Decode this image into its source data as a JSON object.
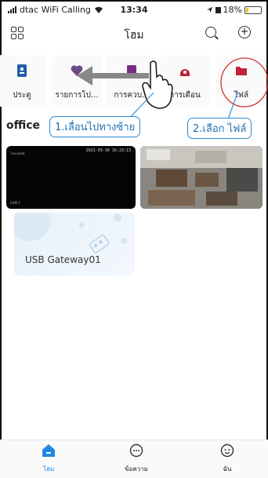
{
  "status_bar": {
    "carrier": "dtac WiFi Calling",
    "time": "13:34",
    "battery_percent": "18%",
    "battery_level": 0.18
  },
  "header": {
    "title": "โฮม"
  },
  "toolbar": {
    "items": [
      {
        "label": "ประตู",
        "icon": "door-lock-icon",
        "color": "#1f5ea8"
      },
      {
        "label": "รายการโป...",
        "icon": "heart-icon",
        "color": "#6b4a8c"
      },
      {
        "label": "การควบ...",
        "icon": "control-icon",
        "color": "#7a2d86"
      },
      {
        "label": "การเตือน",
        "icon": "alert-icon",
        "color": "#c0233a"
      },
      {
        "label": "ไฟล์",
        "icon": "folder-icon",
        "color": "#c0233a"
      }
    ]
  },
  "section": {
    "title": "office"
  },
  "annotations": {
    "step1": "1.เลื่อนไปทางซ้าย",
    "step2": "2.เลือก ไฟล์"
  },
  "cameras": [
    {
      "timestamp": "2021-03-30 16:23:13",
      "label": "โรงแรมร์ท",
      "name": "CAM 1"
    },
    {
      "timestamp": "",
      "label": "",
      "name": ""
    }
  ],
  "gateway": {
    "name": "USB Gateway01"
  },
  "tabbar": {
    "items": [
      {
        "label": "โฮม",
        "icon": "home-icon",
        "active": true
      },
      {
        "label": "ข้อความ",
        "icon": "message-icon",
        "active": false
      },
      {
        "label": "ฉัน",
        "icon": "profile-icon",
        "active": false
      }
    ]
  },
  "colors": {
    "accent": "#1e88e5",
    "callout": "#2a8bd6",
    "highlight_circle": "#d32f2f"
  }
}
